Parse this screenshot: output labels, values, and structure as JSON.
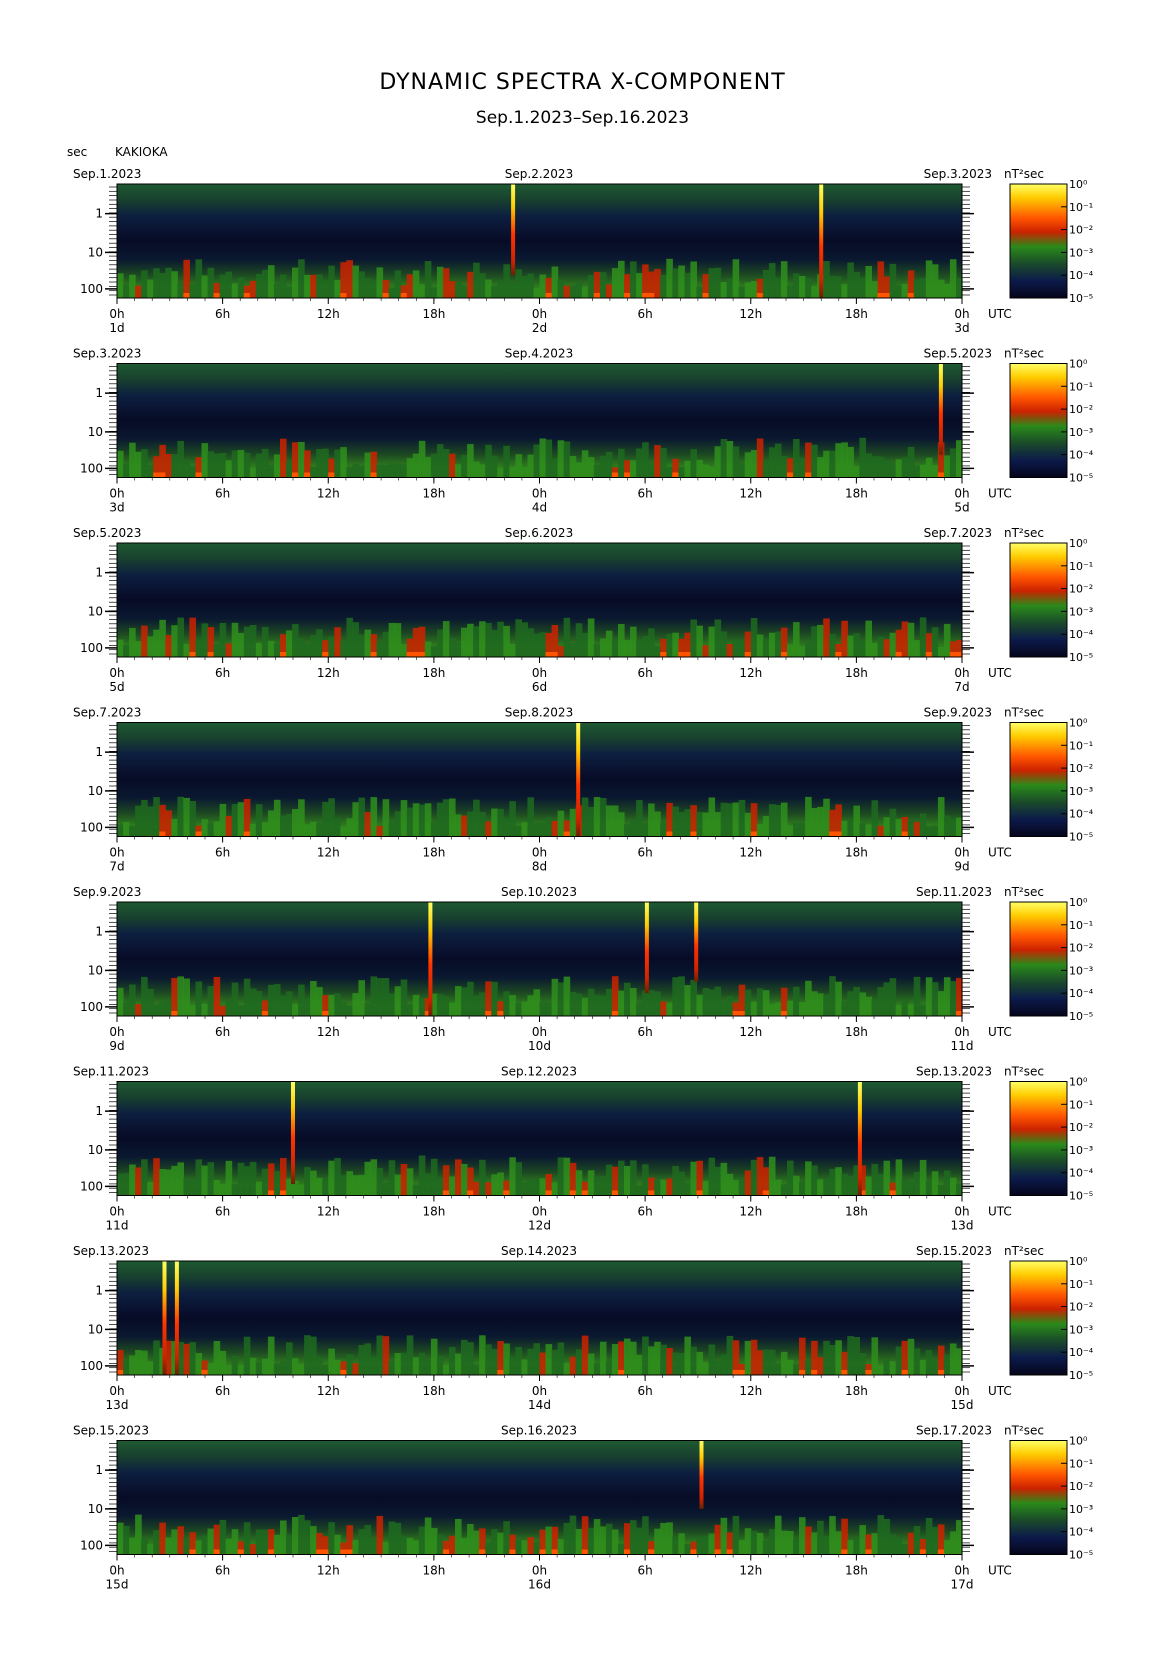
{
  "title": "DYNAMIC SPECTRA X-COMPONENT",
  "subtitle": "Sep.1.2023–Sep.16.2023",
  "unit_axis": "sec",
  "station": "KAKIOKA",
  "utc_label": "UTC",
  "colorbar_unit": "nT²sec",
  "colors": {
    "spectrum": [
      "#05051a",
      "#0c1a4a",
      "#1a4a2a",
      "#2a8a1a",
      "#cc2200",
      "#ff5500",
      "#ffcc00",
      "#ffff66"
    ]
  },
  "chart_data": {
    "type": "heatmap",
    "y_axis": {
      "label": "sec",
      "ticks": [
        "1",
        "10",
        "100"
      ]
    },
    "x_ticks": [
      "0h",
      "6h",
      "12h",
      "18h",
      "0h",
      "6h",
      "12h",
      "18h",
      "0h"
    ],
    "colorbar": {
      "label": "nT²sec",
      "ticks": [
        "10⁰",
        "10⁻¹",
        "10⁻²",
        "10⁻³",
        "10⁻⁴",
        "10⁻⁵"
      ]
    },
    "panels": [
      {
        "left": "Sep.1.2023",
        "mid": "Sep.2.2023",
        "right": "Sep.3.2023",
        "d1": "1d",
        "d2": "2d",
        "d3": "3d",
        "spikes": [
          {
            "hour": 22.5,
            "strength": 0.8
          },
          {
            "hour": 40.0,
            "strength": 1.0
          }
        ]
      },
      {
        "left": "Sep.3.2023",
        "mid": "Sep.4.2023",
        "right": "Sep.5.2023",
        "d1": "3d",
        "d2": "4d",
        "d3": "5d",
        "spikes": [
          {
            "hour": 46.8,
            "strength": 0.8
          }
        ]
      },
      {
        "left": "Sep.5.2023",
        "mid": "Sep.6.2023",
        "right": "Sep.7.2023",
        "d1": "5d",
        "d2": "6d",
        "d3": "7d",
        "spikes": []
      },
      {
        "left": "Sep.7.2023",
        "mid": "Sep.8.2023",
        "right": "Sep.9.2023",
        "d1": "7d",
        "d2": "8d",
        "d3": "9d",
        "spikes": [
          {
            "hour": 26.2,
            "strength": 1.0
          }
        ]
      },
      {
        "left": "Sep.9.2023",
        "mid": "Sep.10.2023",
        "right": "Sep.11.2023",
        "d1": "9d",
        "d2": "10d",
        "d3": "11d",
        "spikes": [
          {
            "hour": 17.8,
            "strength": 1.0
          },
          {
            "hour": 30.1,
            "strength": 0.8
          },
          {
            "hour": 32.9,
            "strength": 0.7
          }
        ]
      },
      {
        "left": "Sep.11.2023",
        "mid": "Sep.12.2023",
        "right": "Sep.13.2023",
        "d1": "11d",
        "d2": "12d",
        "d3": "13d",
        "spikes": [
          {
            "hour": 10.0,
            "strength": 0.9
          },
          {
            "hour": 42.2,
            "strength": 1.0
          }
        ]
      },
      {
        "left": "Sep.13.2023",
        "mid": "Sep.14.2023",
        "right": "Sep.15.2023",
        "d1": "13d",
        "d2": "14d",
        "d3": "15d",
        "spikes": [
          {
            "hour": 2.7,
            "strength": 1.0
          },
          {
            "hour": 3.4,
            "strength": 1.0
          }
        ]
      },
      {
        "left": "Sep.15.2023",
        "mid": "Sep.16.2023",
        "right": "Sep.17.2023",
        "d1": "15d",
        "d2": "16d",
        "d3": "17d",
        "spikes": [
          {
            "hour": 33.2,
            "strength": 0.6
          }
        ]
      }
    ]
  }
}
